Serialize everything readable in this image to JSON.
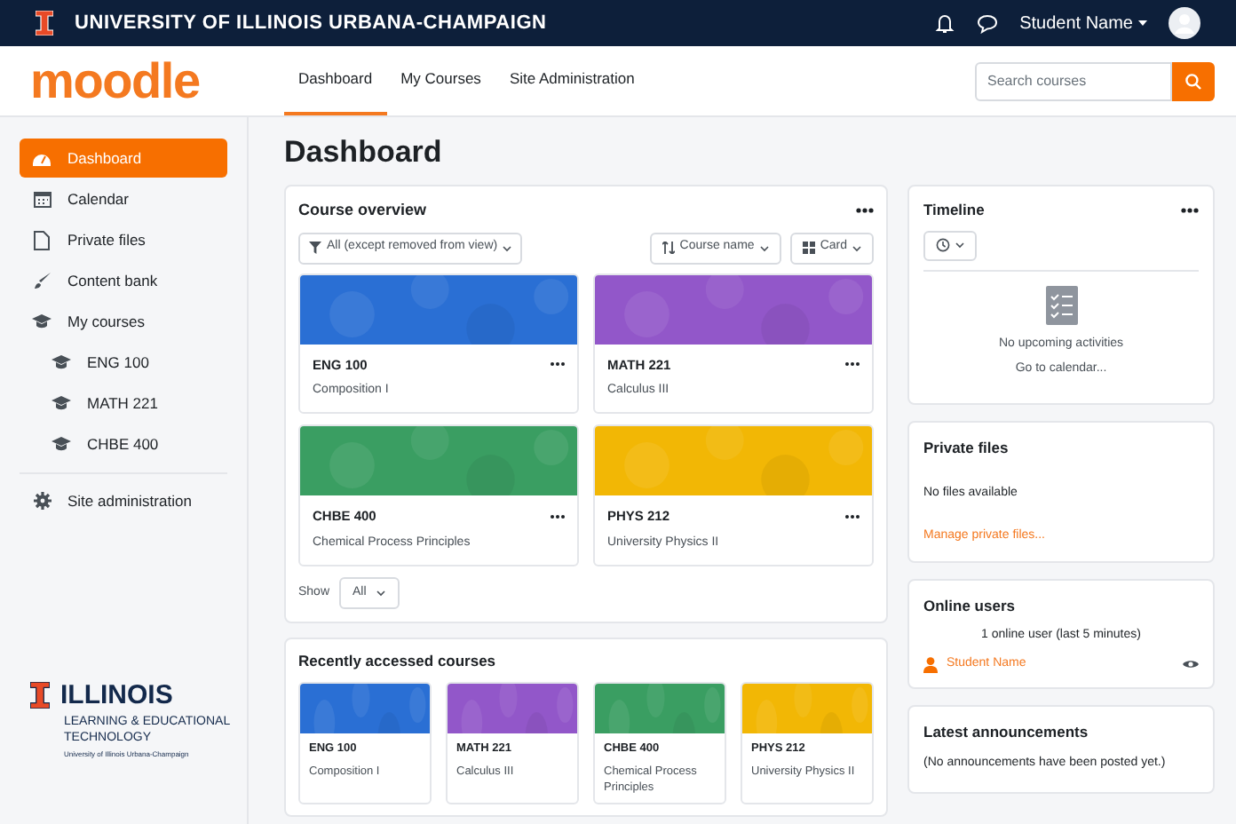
{
  "topbar": {
    "university": "UNIVERSITY OF ILLINOIS URBANA-CHAMPAIGN",
    "user": "Student Name"
  },
  "header": {
    "logo": "moodle",
    "nav": [
      {
        "label": "Dashboard",
        "selected": true
      },
      {
        "label": "My Courses",
        "selected": false
      },
      {
        "label": "Site Administration",
        "selected": false
      }
    ],
    "search": {
      "placeholder": "Search courses"
    }
  },
  "sidebar": {
    "items": [
      {
        "label": "Dashboard",
        "selected": true
      },
      {
        "label": "Calendar",
        "selected": false
      },
      {
        "label": "Private files",
        "selected": false
      },
      {
        "label": "Content bank",
        "selected": false
      },
      {
        "label": "My courses",
        "selected": false,
        "children": [
          {
            "label": "ENG 100",
            "selected": false
          },
          {
            "label": "MATH 221",
            "selected": false
          },
          {
            "label": "CHBE 400",
            "selected": false
          }
        ]
      }
    ],
    "footer_items": [
      {
        "label": "Site administration",
        "selected": false
      }
    ],
    "brand": {
      "name": "ILLINOIS",
      "unit": "LEARNING & EDUCATIONAL TECHNOLOGY",
      "university": "University of Illinois Urbana-Champaign"
    }
  },
  "page_title": "Dashboard",
  "course_overview": {
    "title": "Course overview",
    "filter": "All (except removed from view)",
    "sort": "Course name",
    "view": "Card",
    "courses": [
      {
        "code": "ENG 100",
        "name": "Composition I",
        "color": "#2a6fd4"
      },
      {
        "code": "MATH 221",
        "name": "Calculus III",
        "color": "#9257c9"
      },
      {
        "code": "CHBE 400",
        "name": "Chemical Process Principles",
        "color": "#3a9e62"
      },
      {
        "code": "PHYS 212",
        "name": "University Physics II",
        "color": "#f2b705"
      }
    ],
    "show_label": "Show",
    "show_value": "All"
  },
  "recent": {
    "title": "Recently accessed courses",
    "courses": [
      {
        "code": "ENG 100",
        "name": "Composition I",
        "color": "#2a6fd4"
      },
      {
        "code": "MATH 221",
        "name": "Calculus III",
        "color": "#9257c9"
      },
      {
        "code": "CHBE 400",
        "name": "Chemical Process Principles",
        "color": "#3a9e62"
      },
      {
        "code": "PHYS 212",
        "name": "University Physics II",
        "color": "#f2b705"
      }
    ]
  },
  "timeline": {
    "title": "Timeline",
    "empty": "No upcoming activities",
    "link": "Go to calendar..."
  },
  "private_files": {
    "title": "Private files",
    "empty": "No files available",
    "link": "Manage private files..."
  },
  "online_users": {
    "title": "Online users",
    "summary": "1 online user (last 5 minutes)",
    "users": [
      "Student Name"
    ]
  },
  "announcements": {
    "title": "Latest announcements",
    "empty": "(No announcements have been posted yet.)"
  }
}
